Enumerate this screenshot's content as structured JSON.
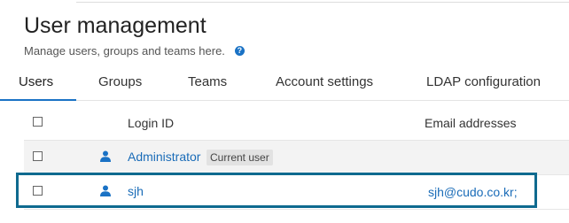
{
  "header": {
    "title": "User management",
    "subtitle": "Manage users, groups and teams here.",
    "help_icon": "?"
  },
  "tabs": [
    {
      "label": "Users",
      "active": true
    },
    {
      "label": "Groups",
      "active": false
    },
    {
      "label": "Teams",
      "active": false
    },
    {
      "label": "Account settings",
      "active": false
    },
    {
      "label": "LDAP configuration",
      "active": false
    }
  ],
  "table": {
    "columns": {
      "login_id": "Login ID",
      "email": "Email addresses"
    },
    "rows": [
      {
        "login": "Administrator",
        "badge": "Current user",
        "email": ""
      },
      {
        "login": "sjh",
        "badge": "",
        "email": "sjh@cudo.co.kr;"
      }
    ]
  },
  "colors": {
    "accent": "#1a72c5",
    "link": "#1a6cb8",
    "highlight_border": "#0f6a8f"
  },
  "icons": [
    "help-icon",
    "user-icon",
    "checkbox-icon"
  ]
}
